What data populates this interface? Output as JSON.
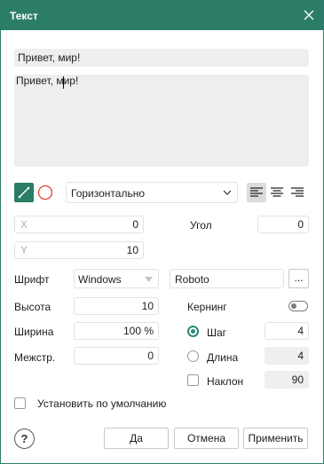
{
  "window": {
    "title": "Текст",
    "close_icon": "close-icon"
  },
  "text": {
    "preview_line": "Привет, мир!",
    "area_text": "Привет, мир!"
  },
  "style": {
    "stroke_icon": "pen-line-icon",
    "fill_icon": "circle-outline-icon",
    "orientation": "Горизонтально",
    "align_icons": [
      "align-left-icon",
      "align-center-icon",
      "align-right-icon"
    ]
  },
  "position": {
    "x_label": "X",
    "x_value": "0",
    "y_label": "Y",
    "y_value": "10",
    "angle_label": "Угол",
    "angle_value": "0"
  },
  "font": {
    "label": "Шрифт",
    "source": "Windows",
    "name": "Roboto",
    "browse_label": "...",
    "height_label": "Высота",
    "height_value": "10",
    "width_label": "Ширина",
    "width_value": "100 %",
    "spacing_label": "Межстр.",
    "spacing_value": "0"
  },
  "kerning": {
    "label": "Кернинг",
    "enabled": false,
    "step_label": "Шаг",
    "step_value": "4",
    "length_label": "Длина",
    "length_value": "4",
    "slant_label": "Наклон",
    "slant_value": "90"
  },
  "default_checkbox_label": "Установить по умолчанию",
  "footer": {
    "help_label": "?",
    "ok_label": "Да",
    "cancel_label": "Отмена",
    "apply_label": "Применить"
  },
  "colors": {
    "accent": "#2b7d67",
    "stroke_color": "#2b8a74",
    "fill_color": "#e0442b"
  }
}
